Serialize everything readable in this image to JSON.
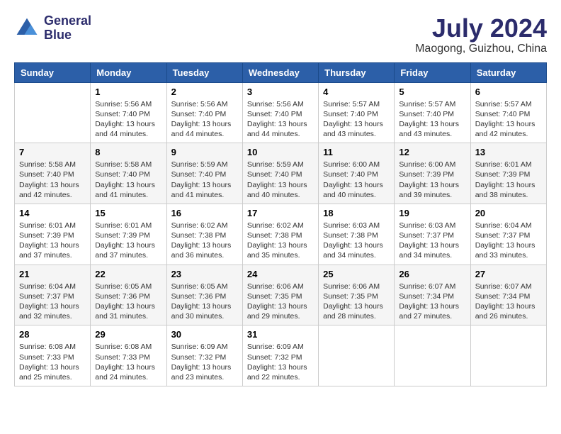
{
  "header": {
    "logo_line1": "General",
    "logo_line2": "Blue",
    "month_year": "July 2024",
    "location": "Maogong, Guizhou, China"
  },
  "days_of_week": [
    "Sunday",
    "Monday",
    "Tuesday",
    "Wednesday",
    "Thursday",
    "Friday",
    "Saturday"
  ],
  "weeks": [
    [
      {
        "day": "",
        "info": ""
      },
      {
        "day": "1",
        "info": "Sunrise: 5:56 AM\nSunset: 7:40 PM\nDaylight: 13 hours\nand 44 minutes."
      },
      {
        "day": "2",
        "info": "Sunrise: 5:56 AM\nSunset: 7:40 PM\nDaylight: 13 hours\nand 44 minutes."
      },
      {
        "day": "3",
        "info": "Sunrise: 5:56 AM\nSunset: 7:40 PM\nDaylight: 13 hours\nand 44 minutes."
      },
      {
        "day": "4",
        "info": "Sunrise: 5:57 AM\nSunset: 7:40 PM\nDaylight: 13 hours\nand 43 minutes."
      },
      {
        "day": "5",
        "info": "Sunrise: 5:57 AM\nSunset: 7:40 PM\nDaylight: 13 hours\nand 43 minutes."
      },
      {
        "day": "6",
        "info": "Sunrise: 5:57 AM\nSunset: 7:40 PM\nDaylight: 13 hours\nand 42 minutes."
      }
    ],
    [
      {
        "day": "7",
        "info": "Sunrise: 5:58 AM\nSunset: 7:40 PM\nDaylight: 13 hours\nand 42 minutes."
      },
      {
        "day": "8",
        "info": "Sunrise: 5:58 AM\nSunset: 7:40 PM\nDaylight: 13 hours\nand 41 minutes."
      },
      {
        "day": "9",
        "info": "Sunrise: 5:59 AM\nSunset: 7:40 PM\nDaylight: 13 hours\nand 41 minutes."
      },
      {
        "day": "10",
        "info": "Sunrise: 5:59 AM\nSunset: 7:40 PM\nDaylight: 13 hours\nand 40 minutes."
      },
      {
        "day": "11",
        "info": "Sunrise: 6:00 AM\nSunset: 7:40 PM\nDaylight: 13 hours\nand 40 minutes."
      },
      {
        "day": "12",
        "info": "Sunrise: 6:00 AM\nSunset: 7:39 PM\nDaylight: 13 hours\nand 39 minutes."
      },
      {
        "day": "13",
        "info": "Sunrise: 6:01 AM\nSunset: 7:39 PM\nDaylight: 13 hours\nand 38 minutes."
      }
    ],
    [
      {
        "day": "14",
        "info": "Sunrise: 6:01 AM\nSunset: 7:39 PM\nDaylight: 13 hours\nand 37 minutes."
      },
      {
        "day": "15",
        "info": "Sunrise: 6:01 AM\nSunset: 7:39 PM\nDaylight: 13 hours\nand 37 minutes."
      },
      {
        "day": "16",
        "info": "Sunrise: 6:02 AM\nSunset: 7:38 PM\nDaylight: 13 hours\nand 36 minutes."
      },
      {
        "day": "17",
        "info": "Sunrise: 6:02 AM\nSunset: 7:38 PM\nDaylight: 13 hours\nand 35 minutes."
      },
      {
        "day": "18",
        "info": "Sunrise: 6:03 AM\nSunset: 7:38 PM\nDaylight: 13 hours\nand 34 minutes."
      },
      {
        "day": "19",
        "info": "Sunrise: 6:03 AM\nSunset: 7:37 PM\nDaylight: 13 hours\nand 34 minutes."
      },
      {
        "day": "20",
        "info": "Sunrise: 6:04 AM\nSunset: 7:37 PM\nDaylight: 13 hours\nand 33 minutes."
      }
    ],
    [
      {
        "day": "21",
        "info": "Sunrise: 6:04 AM\nSunset: 7:37 PM\nDaylight: 13 hours\nand 32 minutes."
      },
      {
        "day": "22",
        "info": "Sunrise: 6:05 AM\nSunset: 7:36 PM\nDaylight: 13 hours\nand 31 minutes."
      },
      {
        "day": "23",
        "info": "Sunrise: 6:05 AM\nSunset: 7:36 PM\nDaylight: 13 hours\nand 30 minutes."
      },
      {
        "day": "24",
        "info": "Sunrise: 6:06 AM\nSunset: 7:35 PM\nDaylight: 13 hours\nand 29 minutes."
      },
      {
        "day": "25",
        "info": "Sunrise: 6:06 AM\nSunset: 7:35 PM\nDaylight: 13 hours\nand 28 minutes."
      },
      {
        "day": "26",
        "info": "Sunrise: 6:07 AM\nSunset: 7:34 PM\nDaylight: 13 hours\nand 27 minutes."
      },
      {
        "day": "27",
        "info": "Sunrise: 6:07 AM\nSunset: 7:34 PM\nDaylight: 13 hours\nand 26 minutes."
      }
    ],
    [
      {
        "day": "28",
        "info": "Sunrise: 6:08 AM\nSunset: 7:33 PM\nDaylight: 13 hours\nand 25 minutes."
      },
      {
        "day": "29",
        "info": "Sunrise: 6:08 AM\nSunset: 7:33 PM\nDaylight: 13 hours\nand 24 minutes."
      },
      {
        "day": "30",
        "info": "Sunrise: 6:09 AM\nSunset: 7:32 PM\nDaylight: 13 hours\nand 23 minutes."
      },
      {
        "day": "31",
        "info": "Sunrise: 6:09 AM\nSunset: 7:32 PM\nDaylight: 13 hours\nand 22 minutes."
      },
      {
        "day": "",
        "info": ""
      },
      {
        "day": "",
        "info": ""
      },
      {
        "day": "",
        "info": ""
      }
    ]
  ]
}
